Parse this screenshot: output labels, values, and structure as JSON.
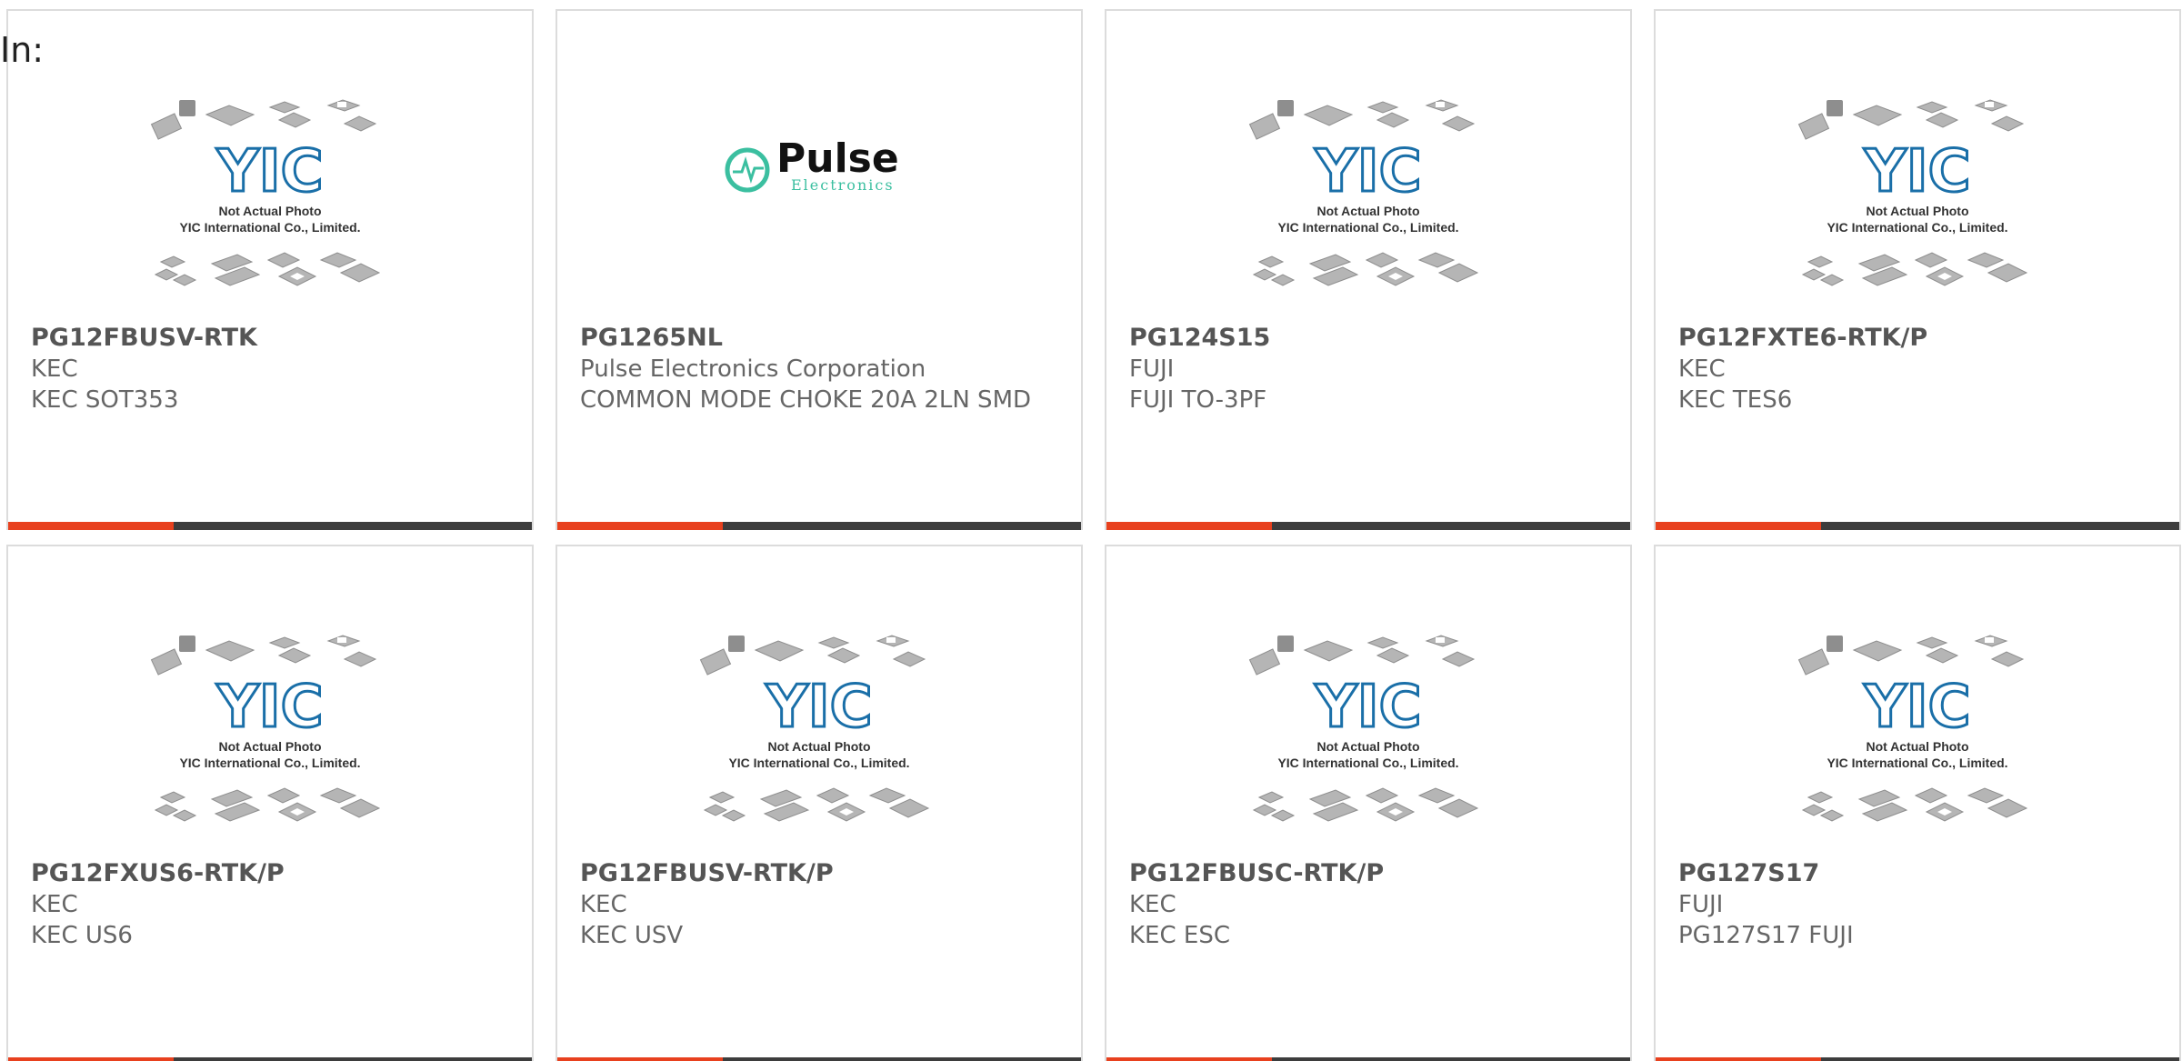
{
  "header": {
    "label": "In:"
  },
  "placeholder_photo": {
    "line1": "Not Actual Photo",
    "line2": "YIC International Co., Limited.",
    "brand": "YIC"
  },
  "pulse_logo": {
    "name": "Pulse",
    "tagline": "Electronics"
  },
  "colors": {
    "accent": "#e8411e",
    "bar": "#3d3d3d",
    "yic_blue": "#1a6fa8",
    "pulse_teal": "#3bbfa0",
    "text": "#666666"
  },
  "products": [
    {
      "part": "PG12FBUSV-RTK",
      "maker": "KEC",
      "desc": "KEC SOT353",
      "image": "placeholder"
    },
    {
      "part": "PG1265NL",
      "maker": "Pulse Electronics Corporation",
      "desc": "COMMON MODE CHOKE 20A 2LN SMD",
      "image": "pulse-logo"
    },
    {
      "part": "PG124S15",
      "maker": "FUJI",
      "desc": "FUJI TO-3PF",
      "image": "placeholder"
    },
    {
      "part": "PG12FXTE6-RTK/P",
      "maker": "KEC",
      "desc": "KEC TES6",
      "image": "placeholder"
    },
    {
      "part": "PG12FXUS6-RTK/P",
      "maker": "KEC",
      "desc": "KEC US6",
      "image": "placeholder"
    },
    {
      "part": "PG12FBUSV-RTK/P",
      "maker": "KEC",
      "desc": "KEC USV",
      "image": "placeholder"
    },
    {
      "part": "PG12FBUSC-RTK/P",
      "maker": "KEC",
      "desc": "KEC ESC",
      "image": "placeholder"
    },
    {
      "part": "PG127S17",
      "maker": "FUJI",
      "desc": "PG127S17 FUJI",
      "image": "placeholder"
    }
  ]
}
